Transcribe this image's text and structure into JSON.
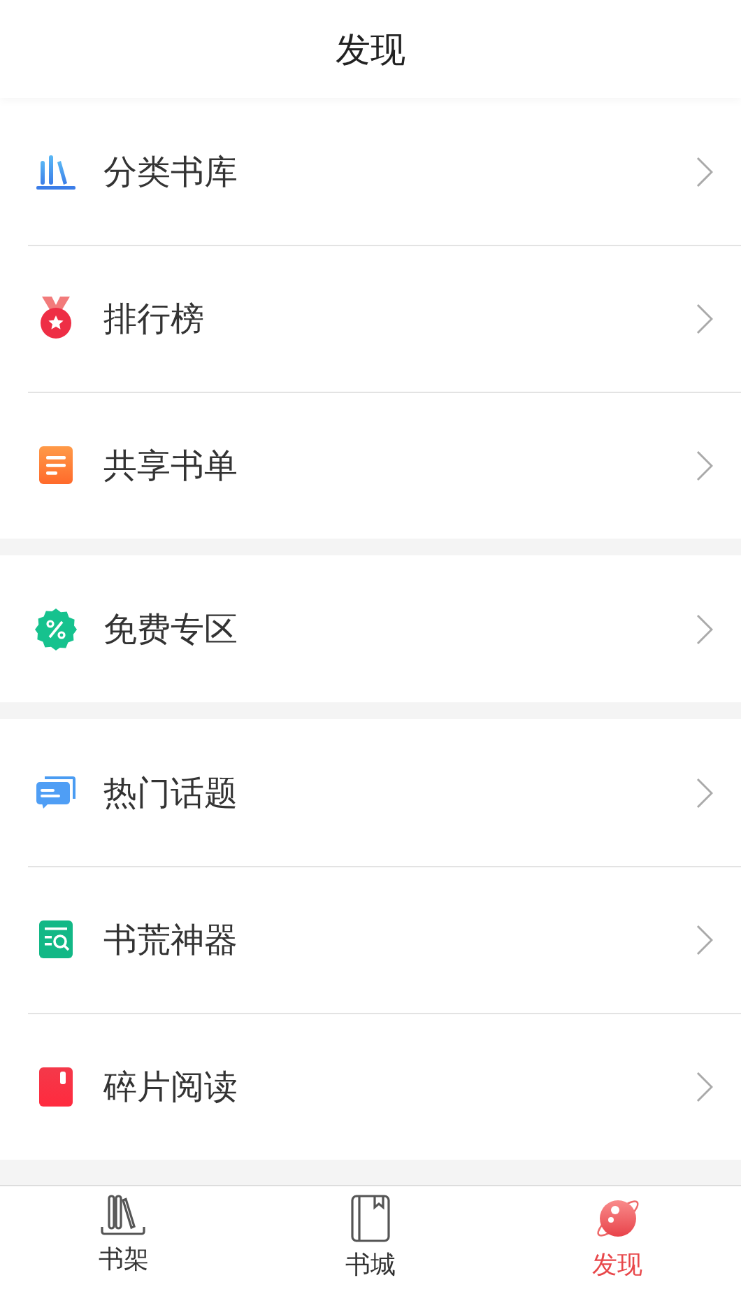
{
  "header": {
    "title": "发现"
  },
  "sections": [
    {
      "items": [
        {
          "kind": "library",
          "label": "分类书库"
        },
        {
          "kind": "medal",
          "label": "排行榜"
        },
        {
          "kind": "list",
          "label": "共享书单"
        }
      ]
    },
    {
      "items": [
        {
          "kind": "free",
          "label": "免费专区"
        }
      ]
    },
    {
      "items": [
        {
          "kind": "chat",
          "label": "热门话题"
        },
        {
          "kind": "finder",
          "label": "书荒神器"
        },
        {
          "kind": "fragment",
          "label": "碎片阅读"
        }
      ]
    }
  ],
  "tab_bar": [
    {
      "kind": "shelf",
      "label": "书架",
      "selected": false
    },
    {
      "kind": "store",
      "label": "书城",
      "selected": false
    },
    {
      "kind": "discover",
      "label": "发现",
      "selected": true
    }
  ]
}
